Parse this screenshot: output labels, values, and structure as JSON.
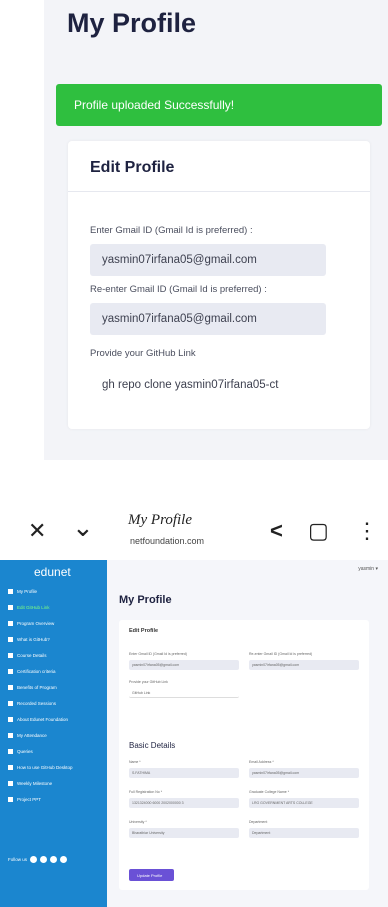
{
  "top": {
    "title": "My Profile",
    "toast": "Profile uploaded Successfully!",
    "card_title": "Edit Profile",
    "fields": [
      {
        "label": "Enter Gmail ID (Gmail Id is preferred) :",
        "value": "yasmin07irfana05@gmail.com"
      },
      {
        "label": "Re-enter Gmail ID (Gmail Id is preferred) :",
        "value": "yasmin07irfana05@gmail.com"
      },
      {
        "label": "Provide your GitHub Link",
        "value": "gh repo clone yasmin07irfana05-ct"
      }
    ]
  },
  "bottom": {
    "toolbar": {
      "close_glyph": "✕",
      "chevron_glyph": "⌄",
      "title": "My Profile",
      "url": "netfoundation.com",
      "share_glyph": "<",
      "bookmark_glyph": "▢",
      "menu_glyph": "⋮"
    },
    "brand": "edunet",
    "nav_items": [
      {
        "label": "My Profile",
        "active": false
      },
      {
        "label": "Edit GitHub Link",
        "active": true
      },
      {
        "label": "Program Overview",
        "active": false
      },
      {
        "label": "What is GitHub?",
        "active": false
      },
      {
        "label": "Course Details",
        "active": false
      },
      {
        "label": "Certification criteria",
        "active": false
      },
      {
        "label": "Benefits of Program",
        "active": false
      },
      {
        "label": "Recorded Sessions",
        "active": false
      },
      {
        "label": "About Edunet Foundation",
        "active": false
      },
      {
        "label": "My Attendance",
        "active": false
      },
      {
        "label": "Queries",
        "active": false
      },
      {
        "label": "How to use GitHub Desktop",
        "active": false
      },
      {
        "label": "Weekly Milestone",
        "active": false
      },
      {
        "label": "Project PPT",
        "active": false
      }
    ],
    "social_label": "Follow us",
    "user_chip": "yasmin ▾",
    "main_title": "My Profile",
    "card_heading": "Edit Profile",
    "gmail_label": "Enter Gmail ID (Gmail Id is preferred)",
    "gmail_value": "yasmin07irfana05@gmail.com",
    "regmail_label": "Re-enter Gmail ID (Gmail Id is preferred)",
    "regmail_value": "yasmin07irfana05@gmail.com",
    "github_label": "Provide your GitHub Link",
    "github_value": "GitHub Link",
    "basic_title": "Basic Details",
    "name_label": "Name *",
    "name_value": "S.FATHIMA",
    "email_label": "Email Address *",
    "email_value": "yasmin07irfana05@gmail.com",
    "reg_label": "Full Registration No *",
    "reg_value": "1321324000 6000 2002000000 3",
    "college_label": "Graduate College Name *",
    "college_value": "LRG GOVERNMENT ARTS COLLEGE",
    "univ_label": "University *",
    "univ_value": "Bharathiar University",
    "dept_label": "Department",
    "dept_value": "Department",
    "update_label": "Update Profile"
  }
}
